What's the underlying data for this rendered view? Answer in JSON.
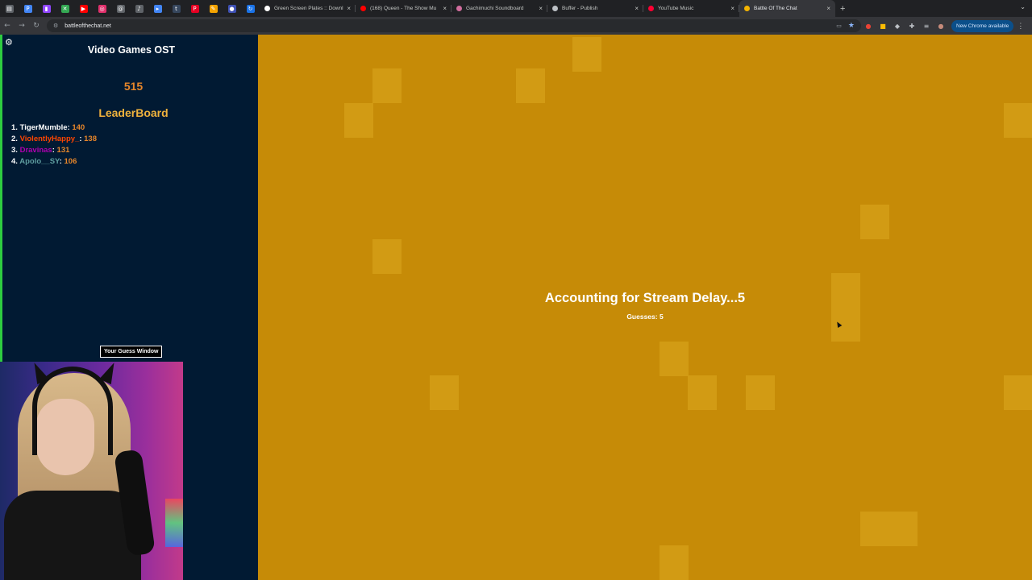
{
  "browser": {
    "pinned_tabs": [
      {
        "icon": "document-icon",
        "color": "#5f6368"
      },
      {
        "icon": "p-app-icon",
        "color": "#4285f4"
      },
      {
        "icon": "twitch-icon",
        "color": "#9146ff"
      },
      {
        "icon": "x-app-icon",
        "color": "#34a853"
      },
      {
        "icon": "youtube-icon",
        "color": "#ff0000"
      },
      {
        "icon": "instagram-icon",
        "color": "#e1306c"
      },
      {
        "icon": "threads-icon",
        "color": "#5f6368"
      },
      {
        "icon": "music-note-icon",
        "color": "#5f6368"
      },
      {
        "icon": "play-icon",
        "color": "#4285f4"
      },
      {
        "icon": "tumblr-icon",
        "color": "#36465d"
      },
      {
        "icon": "pinterest-icon",
        "color": "#e60023"
      },
      {
        "icon": "pen-icon",
        "color": "#f4a300"
      },
      {
        "icon": "user-icon",
        "color": "#3f51b5"
      },
      {
        "icon": "refresh-icon",
        "color": "#1a73e8"
      }
    ],
    "tabs": [
      {
        "title": "Green Screen Plates :: Downl",
        "fav_color": "#ffffff",
        "active": false
      },
      {
        "title": "(168) Queen - The Show Mu",
        "fav_color": "#ff0000",
        "active": false
      },
      {
        "title": "Gachimuchi Soundboard",
        "fav_color": "#d16d9e",
        "active": false
      },
      {
        "title": "Buffer - Publish",
        "fav_color": "#bdc1c6",
        "active": false
      },
      {
        "title": "YouTube Music",
        "fav_color": "#ff0033",
        "active": false
      },
      {
        "title": "Battle Of The Chat",
        "fav_color": "#f4b400",
        "active": true
      }
    ],
    "new_tab_symbol": "+",
    "close_symbol": "×",
    "url": "battleofthechat.net",
    "update_button": "New Chrome available"
  },
  "sidebar": {
    "category": "Video Games OST",
    "score": "515",
    "leaderboard_title": "LeaderBoard",
    "leaderboard": [
      {
        "rank": "1.",
        "name": "TigerMumble",
        "points": "140",
        "color": "#ffffff"
      },
      {
        "rank": "2.",
        "name": "ViolentlyHappy_",
        "points": "138",
        "color": "#ff4500"
      },
      {
        "rank": "3.",
        "name": "Dravinas",
        "points": "131",
        "color": "#b000b0"
      },
      {
        "rank": "4.",
        "name": "Apolo__SY",
        "points": "106",
        "color": "#5f9ea0"
      }
    ],
    "guess_window_button": "Your Guess Window"
  },
  "game": {
    "status": "Accounting for Stream Delay...5",
    "guesses": "Guesses: 5",
    "background_color": "#c68b07",
    "tile_color": "#d29b14"
  }
}
